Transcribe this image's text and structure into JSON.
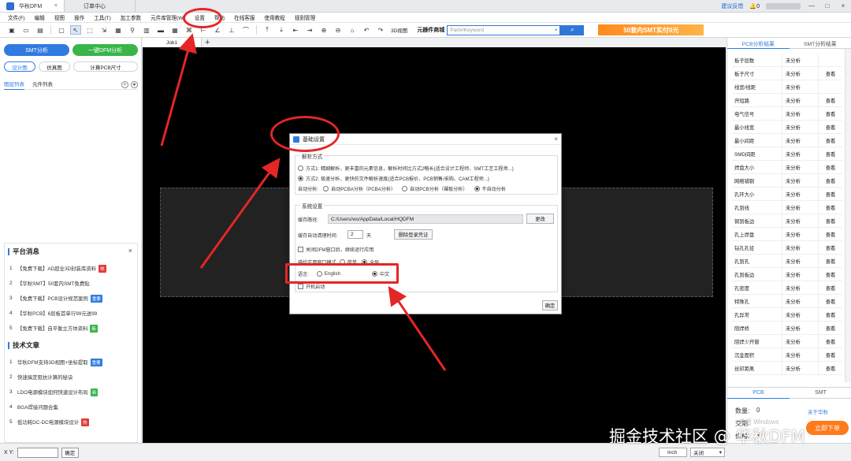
{
  "titlebar": {
    "app_tab": "华秋DFM",
    "close": "×",
    "order_tab": "订单中心",
    "feedback": "建议反馈",
    "bell_count": "0",
    "min": "—",
    "max": "□",
    "win_close": "×"
  },
  "menu": [
    "文件(F)",
    "编辑",
    "视图",
    "操作",
    "工具(T)",
    "加工参数",
    "元件库管理(W)",
    "设置",
    "帮助",
    "在线客服",
    "使用教程",
    "规则管理"
  ],
  "toolbar": {
    "view3d": "3D视图",
    "store_label": "元器件商城",
    "search_placeholder": "Part#/Keyword",
    "promo": "50套内SMT实付0元"
  },
  "left": {
    "smt_btn": "SMT分析",
    "dfm_btn": "一键DFM分析",
    "subtabs": [
      "设计图",
      "仿真图",
      "计算PCB尺寸"
    ],
    "tabs": [
      "图层列表",
      "元件列表"
    ],
    "news_title": "平台消息",
    "news": [
      {
        "n": "1",
        "text": "【免费下载】AD超全3D封装库资料",
        "badge": "热",
        "type": "hot"
      },
      {
        "n": "2",
        "text": "【华秋SMT】50套内SMT免费贴",
        "badge": "",
        "type": ""
      },
      {
        "n": "3",
        "text": "【免费下载】PCB设计规范案例",
        "badge": "重要",
        "type": "imp"
      },
      {
        "n": "4",
        "text": "【华秋PCB】6层板首单行99元送99",
        "badge": "",
        "type": ""
      },
      {
        "n": "5",
        "text": "【免费下载】自平衡立方体资料",
        "badge": "新",
        "type": "new"
      }
    ],
    "articles_title": "技术文章",
    "articles": [
      {
        "n": "1",
        "text": "华秋DFM支持3D视图+坐标提取",
        "badge": "重要",
        "type": "imp"
      },
      {
        "n": "2",
        "text": "快速搞定阻抗计算的秘诀",
        "badge": "",
        "type": ""
      },
      {
        "n": "3",
        "text": "LDO电源模块如何快速设计布局",
        "badge": "新",
        "type": "new"
      },
      {
        "n": "4",
        "text": "BGA焊接问题合集",
        "badge": "",
        "type": ""
      },
      {
        "n": "5",
        "text": "低功耗DC-DC电源模块设计",
        "badge": "热",
        "type": "hot"
      }
    ]
  },
  "canvas": {
    "job_tab": "Job1",
    "plus": "+"
  },
  "dialog": {
    "title": "基础设置",
    "close": "×",
    "parse_group": "解析方式",
    "mode1": "方式1: 精细解析，更丰富的元素信息，解析时间比方式2略长(适合设计工程师、SMT工艺工程师...)",
    "mode2": "方式2: 极速分析，更快的文件解析速度(适合PCB报价、PCB销售/采购、CAM工程师...)",
    "auto_label": "自动分析:",
    "auto_opts": [
      "自动PCBA分析（PCBA分析）",
      "自动PCB分析（裸板分析）",
      "不自动分析"
    ],
    "sys_group": "系统设置",
    "cache_label": "缓存路径:",
    "cache_path": "C:/Users/ws/AppData/Local/HQDFM",
    "change_btn": "更改",
    "clean_label": "缓存自动清理时间:",
    "clean_days": "2",
    "days_unit": "天",
    "logout_btn": "删除登录凭证",
    "close_dfm": "关闭DFM窗口后，继续运行应用",
    "tab_mode_label": "描绘应用窗口模式",
    "tab_mode_opts": [
      "简单",
      "全局"
    ],
    "lang_label": "语言:",
    "lang_opts": [
      "English",
      "中文"
    ],
    "startup": "开机启动",
    "ok": "确定"
  },
  "right": {
    "tabs": [
      "PCB分析结果",
      "SMT分析结果"
    ],
    "rows": [
      {
        "name": "板子层数",
        "status": "未分析",
        "view": ""
      },
      {
        "name": "板子尺寸",
        "status": "未分析",
        "view": "查看"
      },
      {
        "name": "线宽/线距",
        "status": "未分析",
        "view": ""
      },
      {
        "name": "开短路",
        "status": "未分析",
        "view": "查看"
      },
      {
        "name": "电气信号",
        "status": "未分析",
        "view": "查看"
      },
      {
        "name": "最小线宽",
        "status": "未分析",
        "view": "查看"
      },
      {
        "name": "最小间距",
        "status": "未分析",
        "view": "查看"
      },
      {
        "name": "SMD间距",
        "status": "未分析",
        "view": "查看"
      },
      {
        "name": "焊盘大小",
        "status": "未分析",
        "view": "查看"
      },
      {
        "name": "网络铺铜",
        "status": "未分析",
        "view": "查看"
      },
      {
        "name": "孔环大小",
        "status": "未分析",
        "view": "查看"
      },
      {
        "name": "孔到线",
        "status": "未分析",
        "view": "查看"
      },
      {
        "name": "铜到板边",
        "status": "未分析",
        "view": "查看"
      },
      {
        "name": "孔上焊盘",
        "status": "未分析",
        "view": "查看"
      },
      {
        "name": "钻孔孔径",
        "status": "未分析",
        "view": "查看"
      },
      {
        "name": "孔到孔",
        "status": "未分析",
        "view": "查看"
      },
      {
        "name": "孔到板边",
        "status": "未分析",
        "view": "查看"
      },
      {
        "name": "孔密度",
        "status": "未分析",
        "view": "查看"
      },
      {
        "name": "特殊孔",
        "status": "未分析",
        "view": "查看"
      },
      {
        "name": "孔异常",
        "status": "未分析",
        "view": "查看"
      },
      {
        "name": "阻焊桥",
        "status": "未分析",
        "view": "查看"
      },
      {
        "name": "阻焊少开窗",
        "status": "未分析",
        "view": "查看"
      },
      {
        "name": "沉金面积",
        "status": "未分析",
        "view": "查看"
      },
      {
        "name": "丝印距离",
        "status": "未分析",
        "view": "查看"
      }
    ],
    "bottom_tabs": [
      "PCB",
      "SMT"
    ],
    "qty_label": "数量:",
    "qty_value": "0",
    "about": "关于华秋",
    "delivery": "交期:",
    "price_label": "价格:",
    "price_value": "¥",
    "order_btn": "立即下单"
  },
  "status": {
    "xy_label": "X Y:",
    "ok": "确定",
    "unit": "Inch",
    "snap": "关闭",
    "snap_caret": "▾"
  },
  "watermark": "掘金技术社区 @ 华秋DFM",
  "winmark": "激活 Windows",
  "colors": {
    "accent": "#2f7be0",
    "green": "#39b54a",
    "annotation": "#e42626",
    "promo": "#ff8a1f"
  }
}
